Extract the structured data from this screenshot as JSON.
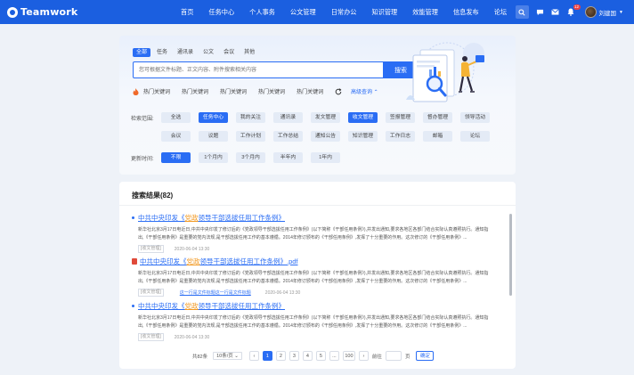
{
  "app": {
    "name": "Teamwork"
  },
  "topnav": {
    "items": [
      "首页",
      "任务中心",
      "个人事务",
      "公文管理",
      "日常办公",
      "知识管理",
      "效能管理",
      "信息发布",
      "论坛"
    ],
    "notification_count": "12",
    "user_name": "刘建国",
    "colors": {
      "bar": "#1b5fe0"
    }
  },
  "search": {
    "tabs": [
      "全部",
      "任务",
      "通讯录",
      "公文",
      "会议",
      "其他"
    ],
    "active_tab": "全部",
    "input_placeholder": "您可根据文件标题、正文内容、附件搜索相关内容",
    "input_value": "",
    "button_label": "搜索",
    "hot_keywords": [
      "热门关键词",
      "热门关键词",
      "热门关键词",
      "热门关键词",
      "热门关键词"
    ],
    "advanced_label": "高级查询 ⌃"
  },
  "filters": {
    "range_label": "检索范围:",
    "range_row1": [
      "全选",
      "任务中心",
      "我的关注",
      "通讯录",
      "发文管理",
      "收文管理",
      "签报管理",
      "督办管理",
      "领导活动"
    ],
    "range_row2": [
      "会议",
      "议题",
      "工作计划",
      "工作总结",
      "通知公告",
      "知识管理",
      "工作日志",
      "邮箱",
      "论坛"
    ],
    "range_selected": [
      "任务中心",
      "收文管理"
    ],
    "time_label": "更新时间:",
    "time_options": [
      "不限",
      "1个月内",
      "3个月内",
      "半年内",
      "1年内"
    ],
    "time_selected": "不限",
    "accent": "#2a6df4"
  },
  "results": {
    "header": "搜索结果(82)",
    "items": [
      {
        "title_prefix": "中共中央印发《",
        "title_highlight": "党政",
        "title_suffix": "领导干部选拔任用工作条例》",
        "body": "新华社北京3月17日电近日,中共中央印发了修订后的《党政领导干部选拔任用工作条例》(以下简称《干部任用条例》),并发出通知,要求各地区各部门结合实际认真遵照执行。通知指出,《干部任用条例》是重要的党内法规,是干部选拔任用工作的基本遵循。2014年修订颁布的《干部任用条例》,发挥了十分重要的作用。这次修订的《干部任用条例》...",
        "tag": "[收文管理]",
        "date": "2020-06-04 13:30"
      },
      {
        "title_prefix": "中共中央印发《",
        "title_highlight": "党政",
        "title_suffix": "领导干部选拔任用工作条例》.pdf",
        "body": "新华社北京3月17日电近日,中共中央印发了修订后的《党政领导干部选拔任用工作条例》(以下简称《干部任用条例》),并发出通知,要求各地区各部门结合实际认真遵照执行。通知指出,《干部任用条例》是重要的党内法规,是干部选拔任用工作的基本遵循。2014年修订颁布的《干部任用条例》,发挥了十分重要的作用。这次修订的《干部任用条例》...",
        "tag": "[收文管理]",
        "attachment": "这一行是文件标题这一行是文件标题",
        "date": "2020-06-04 13:30"
      },
      {
        "title_prefix": "中共中央印发《",
        "title_highlight": "党政",
        "title_suffix": "领导干部选拔任用工作条例》",
        "body": "新华社北京3月17日电近日,中共中央印发了修订后的《党政领导干部选拔任用工作条例》(以下简称《干部任用条例》),并发出通知,要求各地区各部门结合实际认真遵照执行。通知指出,《干部任用条例》是重要的党内法规,是干部选拔任用工作的基本遵循。2014年修订颁布的《干部任用条例》,发挥了十分重要的作用。这次修订的《干部任用条例》...",
        "tag": "[收文管理]",
        "date": "2020-06-04 13:30"
      }
    ]
  },
  "pagination": {
    "total_label": "共82条",
    "page_size": "10条/页 ⌄",
    "prev": "‹",
    "pages": [
      "1",
      "2",
      "3",
      "4",
      "5",
      "...",
      "100"
    ],
    "current": "1",
    "next": "›",
    "goto_label": "前往",
    "page_unit": "页",
    "confirm": "确定"
  }
}
